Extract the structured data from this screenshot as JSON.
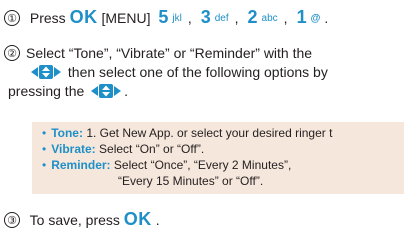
{
  "step1": {
    "number": "①",
    "press": "Press",
    "ok": "OK",
    "menu": "[MENU]",
    "keys": [
      {
        "digit": "5",
        "letters": "jkl"
      },
      {
        "digit": "3",
        "letters": "def"
      },
      {
        "digit": "2",
        "letters": "abc"
      },
      {
        "digit": "1",
        "letters": "@"
      }
    ],
    "separator": ",",
    "end": "."
  },
  "step2": {
    "number": "②",
    "line1": "Select “Tone”, “Vibrate” or “Reminder” with the",
    "line2": "then select one of the following options by",
    "line3_prefix": "pressing the",
    "line3_suffix": "."
  },
  "options": {
    "tone_label": "Tone:",
    "tone_text": "1. Get New App. or select your desired ringer t",
    "vibrate_label": "Vibrate:",
    "vibrate_text": "Select “On” or “Off”.",
    "reminder_label": "Reminder:",
    "reminder_text": "Select “Once”, “Every 2 Minutes”,",
    "reminder_text2": "“Every 15 Minutes” or “Off”."
  },
  "step3": {
    "number": "③",
    "text": "To save, press",
    "ok": "OK",
    "end": "."
  },
  "colors": {
    "accent": "#1f8fc8",
    "panel": "#f6e7dc",
    "text": "#231f20"
  },
  "icons": {
    "nav": "navigation-key-icon"
  }
}
